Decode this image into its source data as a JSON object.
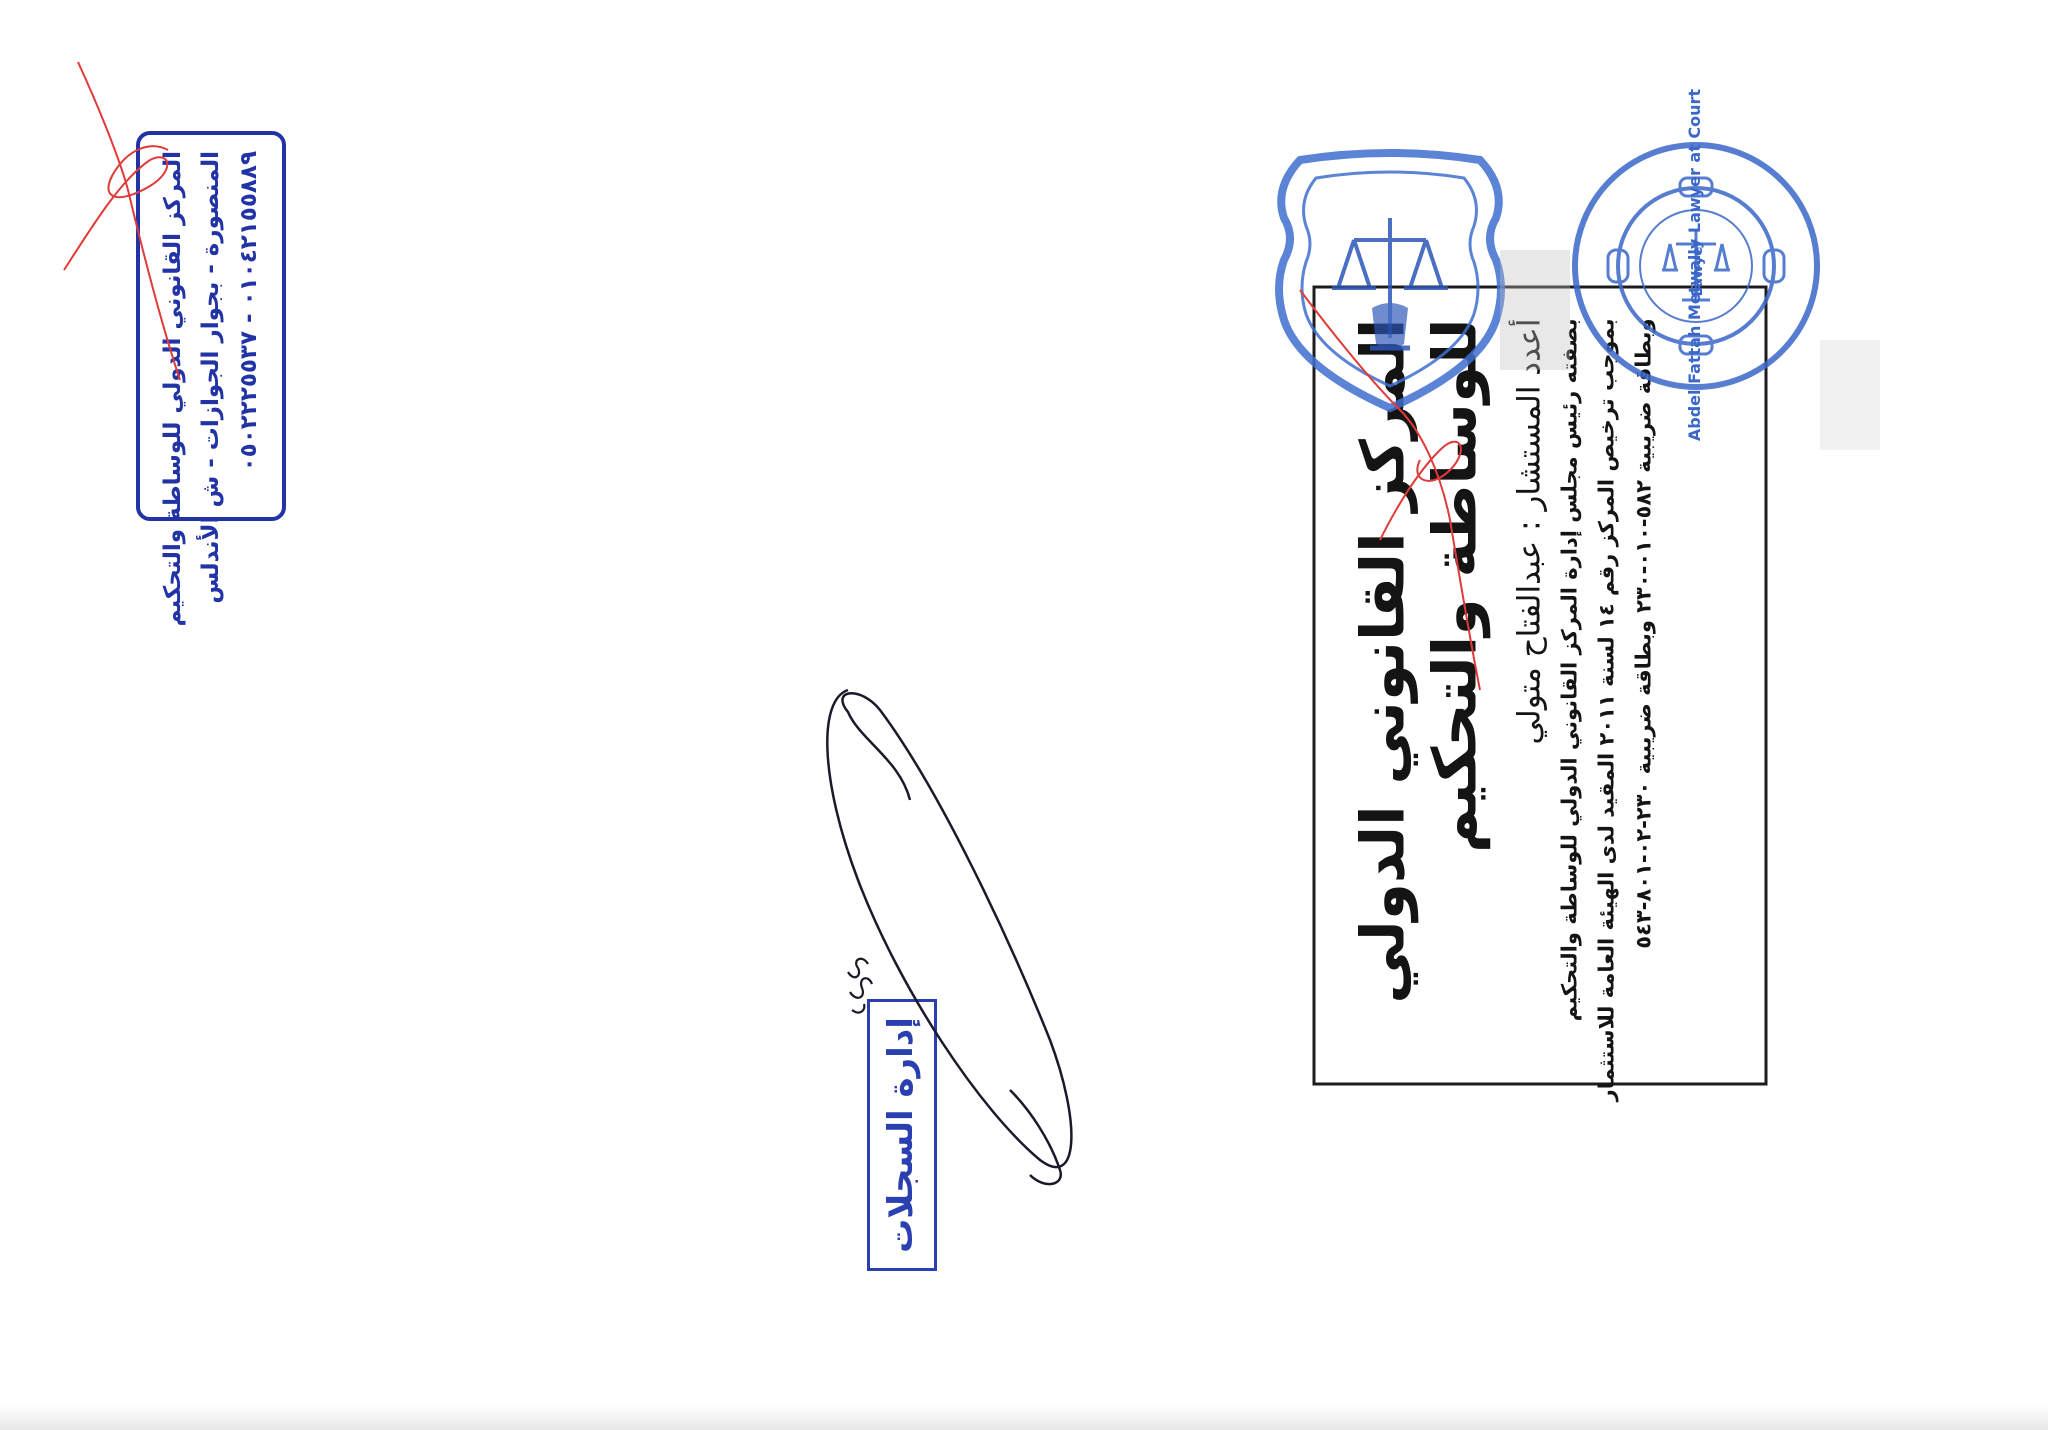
{
  "letterhead": {
    "title_line1": "المركز القانوني الدولي",
    "title_line2": "للوساطة والتحكيم",
    "prepared_by": "أعدد المستشار : عبدالفتاح متولي",
    "registration_line1": "بصفته رئيس مجلس إدارة المركز القانوني الدولي للوساطة والتحكيم",
    "registration_line2": "بموجب ترخيص المركز رقم ١٤ لسنة ٢٠١١ المقيد لدى الهيئة العامة للاستثمار",
    "registration_line3": "وبطاقة ضريبية ٥٨٢-٠١٠-٢٣٠ وبطاقة ضريبية ٢٣٠-٠٢-٨٠١-٥٤٣"
  },
  "round_seal": {
    "outer_text": "Abdel Fattah Metwally Lawyer at Court",
    "center_text": "Lawyer"
  },
  "small_stamp": {
    "line1": "المركز القانوني الدولي للوساطة والتحكيم",
    "line2": "المنصورة - بجوار الجوازات - ش الأندلس",
    "line3": "٠١٠٤٢١٥٥٨٨٩ - ٠٥٠٢٢٢٥٥٣٧"
  },
  "registry_stamp": {
    "label": "إدارة السجلات"
  },
  "colors": {
    "stamp_blue": "#2233a6",
    "seal_blue": "#3a67c9",
    "ink_red": "#e03a3a",
    "ink_dark": "#1a1a2a"
  }
}
